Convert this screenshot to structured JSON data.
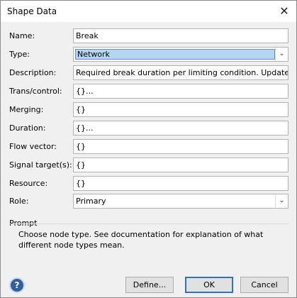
{
  "window": {
    "title": "Shape Data"
  },
  "fields": {
    "name": {
      "label": "Name:",
      "value": "Break"
    },
    "type": {
      "label": "Type:",
      "value": "Network"
    },
    "description": {
      "label": "Description:",
      "value": "Required break duration per limiting condition. Update ho"
    },
    "trans": {
      "label": "Trans/control:",
      "value": "{}..."
    },
    "merging": {
      "label": "Merging:",
      "value": "{}"
    },
    "duration": {
      "label": "Duration:",
      "value": "{}..."
    },
    "flow": {
      "label": "Flow vector:",
      "value": "{}"
    },
    "signal": {
      "label": "Signal target(s):",
      "value": "{}"
    },
    "resource": {
      "label": "Resource:",
      "value": "{}"
    },
    "role": {
      "label": "Role:",
      "value": "Primary"
    }
  },
  "prompt": {
    "heading": "Prompt",
    "text": "Choose node type. See documentation for explanation of what different node types mean."
  },
  "buttons": {
    "help": "?",
    "define": "Define...",
    "ok": "OK",
    "cancel": "Cancel"
  },
  "icons": {
    "close": "close-icon",
    "dropdown": "chevron-down-icon",
    "help": "help-icon"
  }
}
